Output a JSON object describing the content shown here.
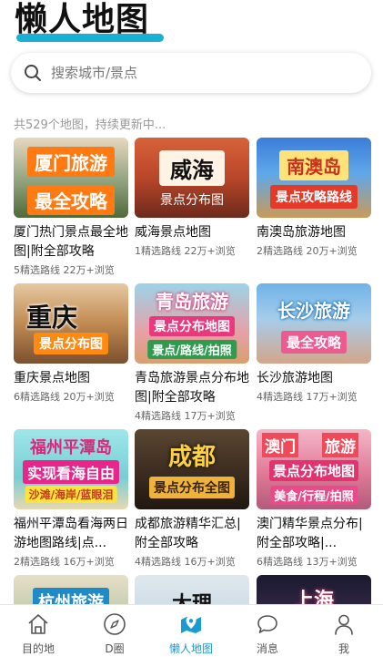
{
  "app": {
    "title": "懒人地图"
  },
  "search": {
    "placeholder": "搜索城市/景点"
  },
  "count_text": "共529个地图，持续更新中...",
  "cards": [
    {
      "title": "厦门热门景点最全地图|附全部攻略",
      "meta": "5精选路线 22万+浏览",
      "thumb_lines": [
        "厦门旅游",
        "最全攻略"
      ]
    },
    {
      "title": "威海景点地图",
      "meta": "1精选路线 22万+浏览",
      "thumb_lines": [
        "威海",
        "景点分布图"
      ]
    },
    {
      "title": "南澳岛旅游地图",
      "meta": "2精选路线 20万+浏览",
      "thumb_lines": [
        "南澳岛",
        "景点攻略路线"
      ]
    },
    {
      "title": "重庆景点地图",
      "meta": "6精选路线 20万+浏览",
      "thumb_lines": [
        "重庆",
        "景点分布图"
      ]
    },
    {
      "title": "青岛旅游景点分布地图|附全部攻略",
      "meta": "4精选路线 17万+浏览",
      "thumb_lines": [
        "青岛旅游",
        "景点分布地图",
        "景点/路线/拍照"
      ]
    },
    {
      "title": "长沙旅游地图",
      "meta": "4精选路线 17万+浏览",
      "thumb_lines": [
        "长沙旅游",
        "最全攻略"
      ]
    },
    {
      "title": "福州平潭岛看海两日游地图路线|点...",
      "meta": "2精选路线 16万+浏览",
      "thumb_lines": [
        "福州平潭岛",
        "实现看海自由",
        "沙滩/海岸/蓝眼泪"
      ]
    },
    {
      "title": "成都旅游精华汇总|附全部攻略",
      "meta": "4精选路线 16万+浏览",
      "thumb_lines": [
        "成都",
        "景点分布全图"
      ]
    },
    {
      "title": "澳门精华景点分布|附全部攻略|...",
      "meta": "6精选路线 13万+浏览",
      "thumb_lines": [
        "澳门",
        "旅游",
        "景点分布地图",
        "美食/行程/拍照"
      ]
    },
    {
      "title": "",
      "meta": "",
      "thumb_lines": [
        "杭州旅游"
      ]
    },
    {
      "title": "",
      "meta": "",
      "thumb_lines": [
        "大理"
      ]
    },
    {
      "title": "",
      "meta": "",
      "thumb_lines": [
        "上海"
      ]
    }
  ],
  "tabs": [
    {
      "label": "目的地",
      "icon": "home-icon"
    },
    {
      "label": "D圈",
      "icon": "compass-icon"
    },
    {
      "label": "懒人地图",
      "icon": "map-pin-icon",
      "active": true
    },
    {
      "label": "消息",
      "icon": "chat-bubble-icon"
    },
    {
      "label": "我",
      "icon": "user-icon"
    }
  ],
  "colors": {
    "accent": "#1ab0d6",
    "active_tab": "#1a9bd0"
  }
}
